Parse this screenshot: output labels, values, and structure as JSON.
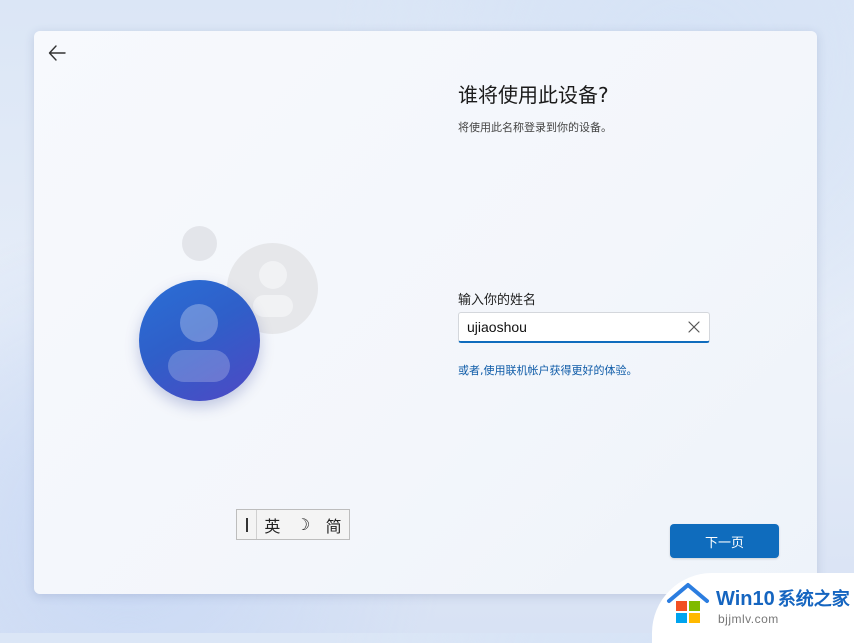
{
  "header": {
    "back_icon": "arrow-left-icon"
  },
  "main": {
    "title": "谁将使用此设备?",
    "subtitle": "将使用此名称登录到你的设备。",
    "name_label": "输入你的姓名",
    "name_value": "ujiaoshou",
    "clear_icon": "close-icon",
    "online_link": "或者,使用联机帐户获得更好的体验。",
    "next_label": "下一页"
  },
  "ime": {
    "mode": "英",
    "moon_glyph": "☽",
    "script": "简"
  },
  "watermark": {
    "brand": "Win10",
    "brand_cn": "系统之家",
    "url": "bjjmlv.com"
  },
  "colors": {
    "accent": "#0f6cbd",
    "link": "#0f5ca8",
    "avatar_blue": "#2f5fc9",
    "avatar_gray": "#e6e7ea"
  }
}
